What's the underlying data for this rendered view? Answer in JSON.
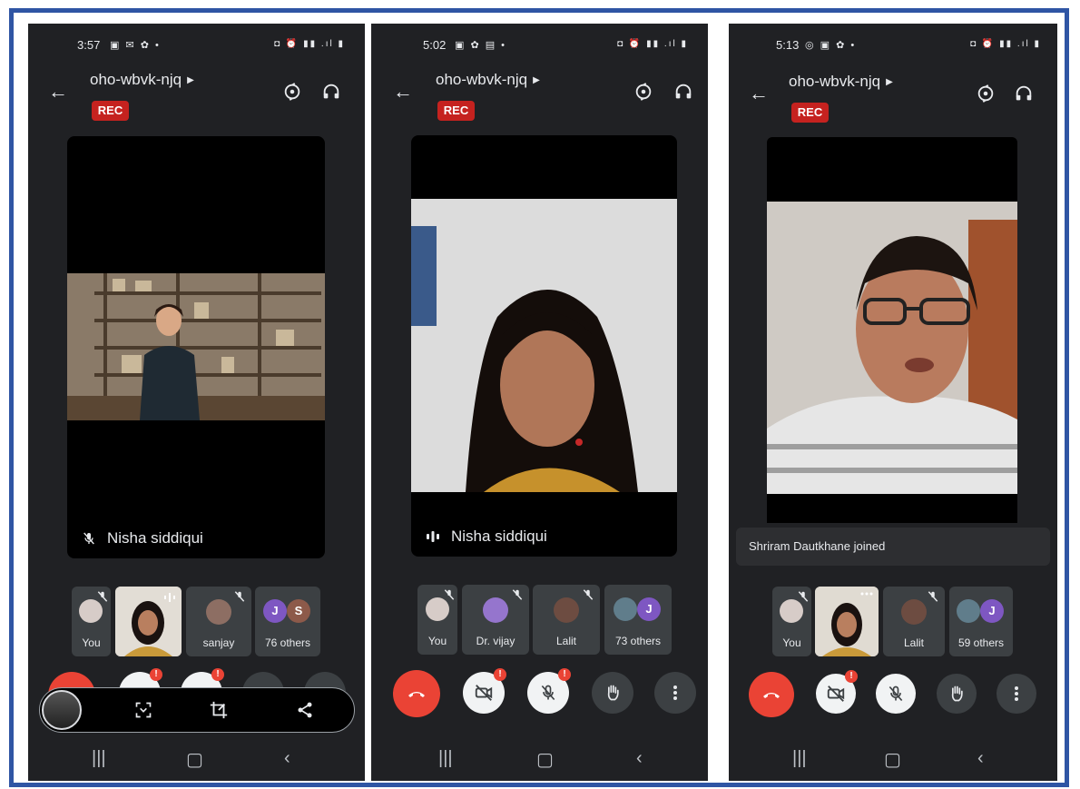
{
  "phones": [
    {
      "status_time": "3:57",
      "meeting_code": "oho-wbvk-njq",
      "rec_label": "REC",
      "speaker_name": "Nisha siddiqui",
      "strip": [
        {
          "name": "You"
        },
        {
          "name": ""
        },
        {
          "name": "sanjay"
        },
        {
          "name": "76 others",
          "letters": [
            "J",
            "S"
          ]
        }
      ],
      "badges": [
        "!",
        "!"
      ]
    },
    {
      "status_time": "5:02",
      "meeting_code": "oho-wbvk-njq",
      "rec_label": "REC",
      "speaker_name": "Nisha siddiqui",
      "strip": [
        {
          "name": "You"
        },
        {
          "name": "Dr. vijay"
        },
        {
          "name": "Lalit"
        },
        {
          "name": "73 others",
          "letters": [
            "J"
          ]
        }
      ],
      "badges": [
        "!",
        "!"
      ]
    },
    {
      "status_time": "5:13",
      "meeting_code": "oho-wbvk-njq",
      "rec_label": "REC",
      "toast": "Shriram Dautkhane joined",
      "strip": [
        {
          "name": "You"
        },
        {
          "name": ""
        },
        {
          "name": "Lalit"
        },
        {
          "name": "59 others",
          "letters": [
            "J"
          ]
        }
      ],
      "badges": [
        "!"
      ]
    }
  ],
  "colors": {
    "frame_border": "#2f55a4",
    "background": "#202124",
    "tile": "#3c4043",
    "hangup": "#ea4335",
    "rec": "#c5221f",
    "avatar_purple": "#7e57c2",
    "avatar_brown": "#8d5a4a"
  },
  "icons": {
    "back": "arrow-left-icon",
    "switch_camera": "switch-camera-icon",
    "audio": "headphones-icon",
    "mic_off": "mic-off-icon",
    "speaking": "audio-level-icon",
    "hangup": "phone-hangup-icon",
    "camera_off": "camera-off-icon",
    "raise_hand": "hand-icon",
    "more": "more-vert-icon",
    "nav_recents": "recents-icon",
    "nav_home": "home-icon",
    "nav_back": "nav-back-icon"
  }
}
